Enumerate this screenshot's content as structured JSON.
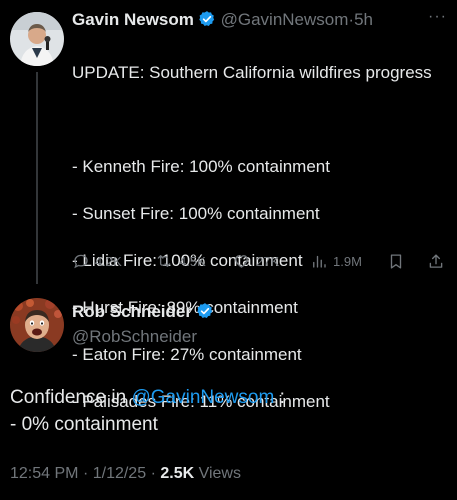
{
  "quoted_tweet": {
    "author_name": "Gavin Newsom",
    "handle": "@GavinNewsom",
    "separator": "·",
    "time": "5h",
    "more": "···",
    "text_lines": [
      "UPDATE: Southern California wildfires progress",
      "",
      "- Kenneth Fire: 100% containment",
      "- Sunset Fire: 100% containment",
      "- Lidia Fire: 100% containment",
      "- Hurst Fire: 89% containment",
      "- Eaton Fire: 27% containment",
      "- Palisades Fire: 11% containment"
    ],
    "stats": {
      "replies": "4.2K",
      "reposts": "4.5K",
      "likes": "27K",
      "views": "1.9M"
    }
  },
  "tweet": {
    "author_name": "Rob Schneider",
    "handle": "@RobSchneider",
    "text_before": "Confidence in ",
    "mention": "@GavinNewsom",
    "text_after": " :",
    "line2": "- 0% containment",
    "time": "12:54 PM",
    "date": "1/12/25",
    "dot": "·",
    "views_count": "2.5K",
    "views_label": "Views"
  },
  "colors": {
    "background": "#000000",
    "text": "#e7e9ea",
    "muted": "#71767b",
    "accent": "#1d9bf0"
  }
}
